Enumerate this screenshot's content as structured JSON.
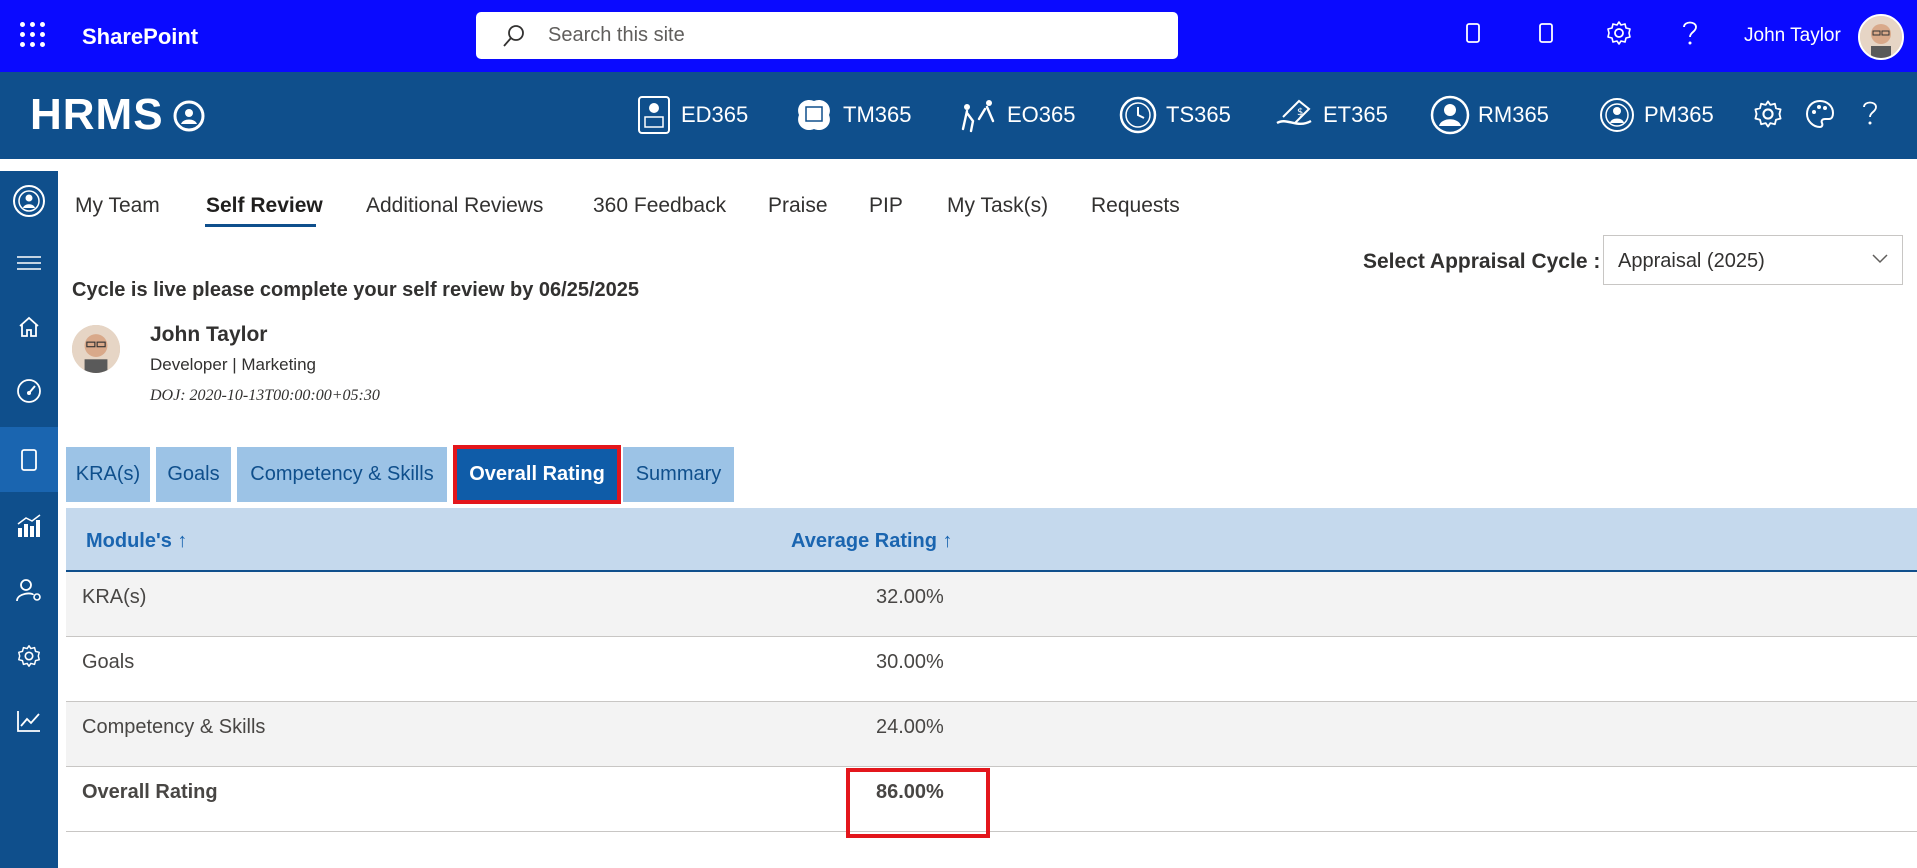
{
  "sharepoint": {
    "title": "SharePoint",
    "search_placeholder": "Search this site",
    "user_name": "John Taylor"
  },
  "hrms": {
    "logo": "HRMS",
    "modules": [
      {
        "label": "ED365",
        "icon": "ed365-icon"
      },
      {
        "label": "TM365",
        "icon": "tm365-icon"
      },
      {
        "label": "EO365",
        "icon": "eo365-icon"
      },
      {
        "label": "TS365",
        "icon": "ts365-icon"
      },
      {
        "label": "ET365",
        "icon": "et365-icon"
      },
      {
        "label": "RM365",
        "icon": "rm365-icon"
      },
      {
        "label": "PM365",
        "icon": "pm365-icon"
      }
    ]
  },
  "rail": [
    "user-circle-icon",
    "hamburger-icon",
    "home-icon",
    "gauge-icon",
    "document-icon",
    "bar-chart-icon",
    "user-settings-icon",
    "gear-icon",
    "line-chart-icon"
  ],
  "tabs": [
    {
      "label": "My Team"
    },
    {
      "label": "Self Review",
      "active": true
    },
    {
      "label": "Additional Reviews"
    },
    {
      "label": "360 Feedback"
    },
    {
      "label": "Praise"
    },
    {
      "label": "PIP"
    },
    {
      "label": "My Task(s)"
    },
    {
      "label": "Requests"
    }
  ],
  "cycle": {
    "label": "Select Appraisal Cycle :",
    "value": "Appraisal (2025)",
    "notice": "Cycle is live please complete your self review by 06/25/2025"
  },
  "profile": {
    "name": "John Taylor",
    "role": "Developer | Marketing",
    "doj": "DOJ: 2020-10-13T00:00:00+05:30"
  },
  "sub_tabs": [
    {
      "label": "KRA(s)"
    },
    {
      "label": "Goals"
    },
    {
      "label": "Competency & Skills"
    },
    {
      "label": "Overall Rating",
      "active": true
    },
    {
      "label": "Summary"
    }
  ],
  "table": {
    "headers": [
      "Module's ↑",
      "Average Rating ↑"
    ],
    "rows": [
      {
        "module": "KRA(s)",
        "rating": "32.00%"
      },
      {
        "module": "Goals",
        "rating": "30.00%"
      },
      {
        "module": "Competency & Skills",
        "rating": "24.00%"
      },
      {
        "module": "Overall Rating",
        "rating": "86.00%",
        "total": true
      }
    ]
  },
  "colors": {
    "sharepoint_bar": "#0a0aff",
    "hrms_bar": "#0f4f8c",
    "highlight": "#e3161c",
    "active_subtab": "#0f5ca8",
    "subtab": "#9cc3e6"
  }
}
